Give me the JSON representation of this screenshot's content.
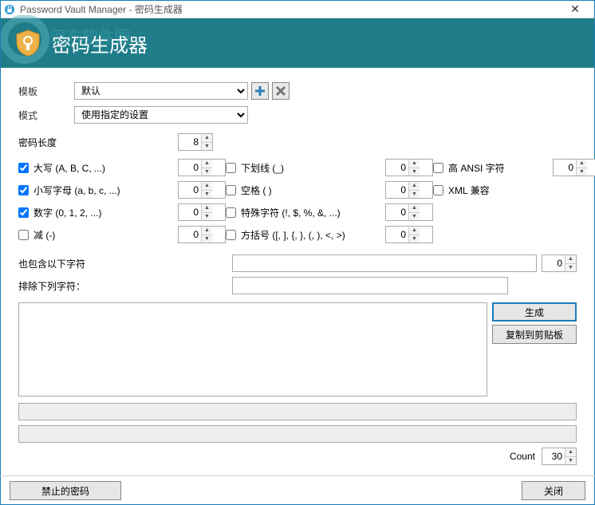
{
  "window": {
    "title": "Password Vault Manager - 密码生成器"
  },
  "header": {
    "title": "密码生成器"
  },
  "labels": {
    "template": "模板",
    "mode": "模式",
    "pwd_len": "密码长度",
    "include": "也包含以下字符",
    "exclude": "排除下列字符：",
    "count": "Count"
  },
  "template": {
    "selected": "默认"
  },
  "mode": {
    "selected": "使用指定的设置"
  },
  "length": {
    "value": "8"
  },
  "options": {
    "upper": {
      "label": "大写 (A, B, C, ...)",
      "checked": true,
      "min": "0"
    },
    "lower": {
      "label": "小写字母 (a, b, c, ...)",
      "checked": true,
      "min": "0"
    },
    "digits": {
      "label": "数字 (0, 1, 2, ...)",
      "checked": true,
      "min": "0"
    },
    "minus": {
      "label": "减 (-)",
      "checked": false,
      "min": "0"
    },
    "under": {
      "label": "下划线 (_)",
      "checked": false,
      "min": "0"
    },
    "space": {
      "label": "空格 ( )",
      "checked": false,
      "min": "0"
    },
    "special": {
      "label": "特殊字符 (!, $, %, &, ...)",
      "checked": false,
      "min": "0"
    },
    "bracket": {
      "label": "方括号 ([, ], {, }, (, ), <, >)",
      "checked": false,
      "min": "0"
    },
    "ansi": {
      "label": "高 ANSI 字符",
      "checked": false,
      "min": "0"
    },
    "xml": {
      "label": "XML 兼容",
      "checked": false
    }
  },
  "include": {
    "value": "",
    "min": "0"
  },
  "exclude": {
    "value": ""
  },
  "buttons": {
    "generate": "生成",
    "copy": "复制到剪贴板",
    "forbidden": "禁止的密码",
    "close": "关闭"
  },
  "count": {
    "value": "30"
  }
}
